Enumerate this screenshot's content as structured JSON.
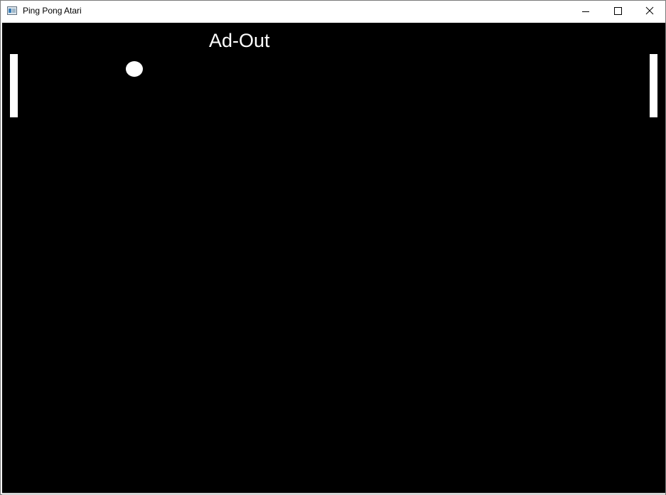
{
  "window": {
    "title": "Ping Pong Atari",
    "icon": "app-window-icon",
    "controls": {
      "minimize_icon": "minimize-icon",
      "maximize_icon": "maximize-icon",
      "close_icon": "close-icon"
    }
  },
  "game": {
    "score_text": "Ad-Out",
    "background_color": "#000000",
    "foreground_color": "#ffffff"
  }
}
